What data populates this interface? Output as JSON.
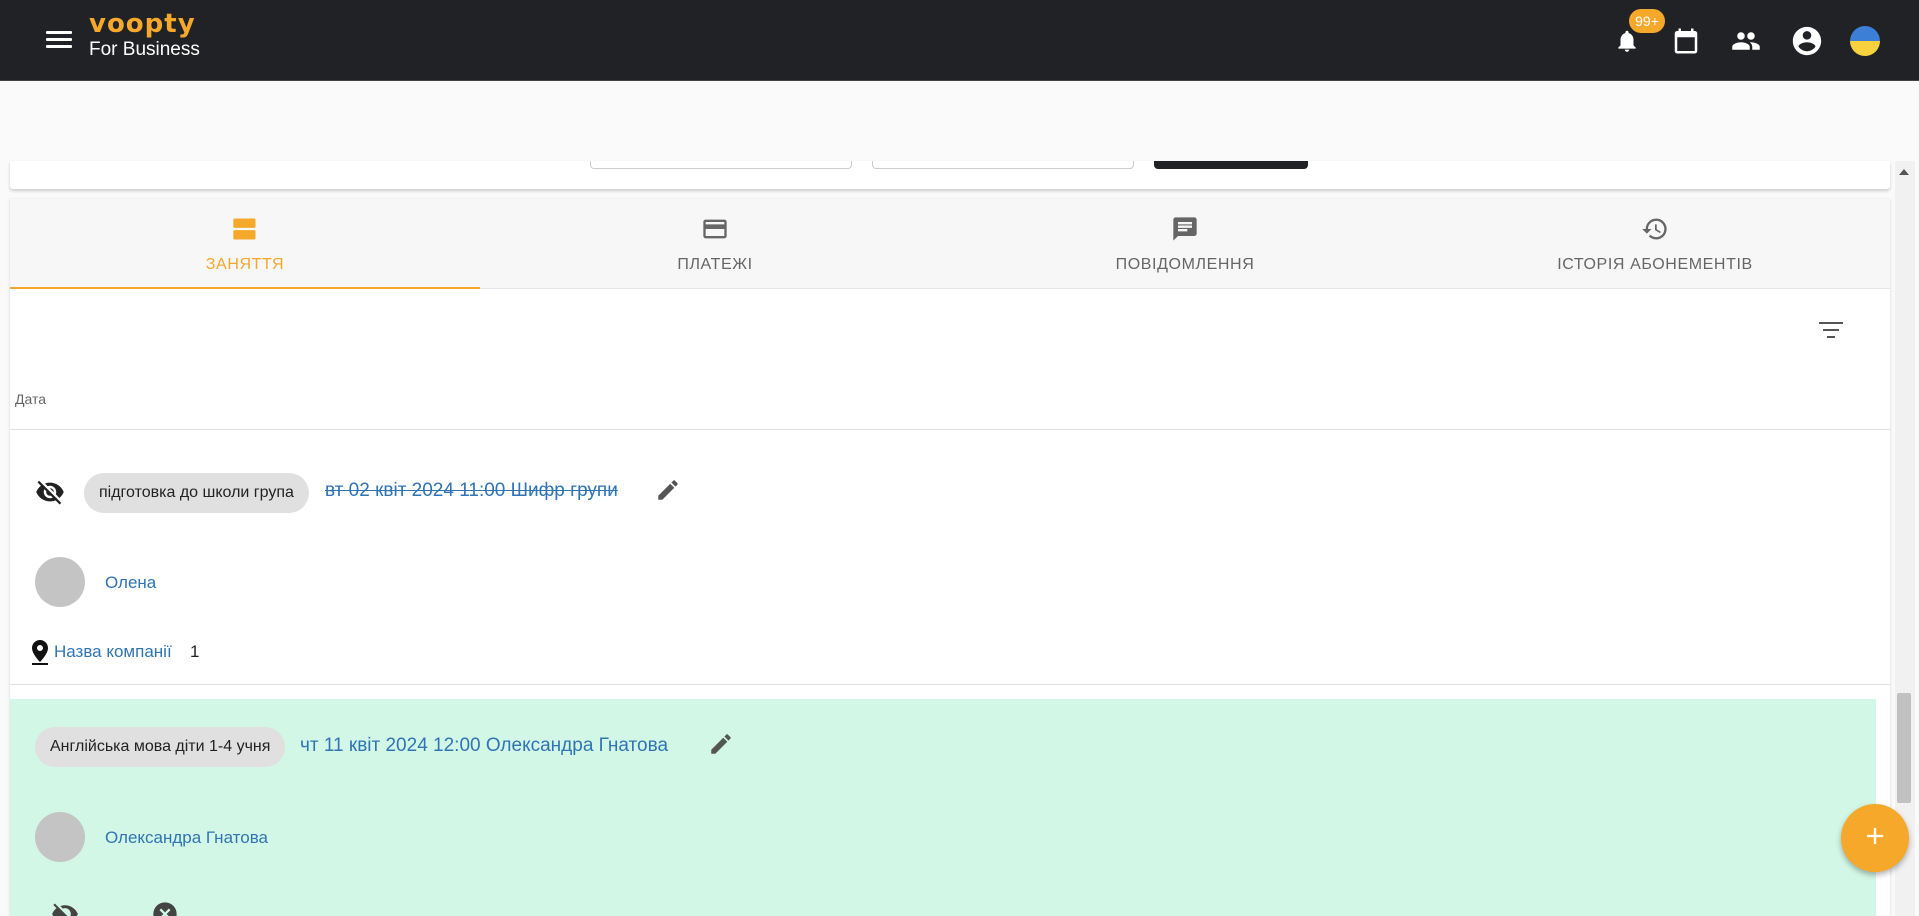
{
  "app": {
    "brand_name": "voopty",
    "brand_sub": "For Business",
    "notification_badge": "99+",
    "accent_color": "#f6a82b",
    "appbar_color": "#212225"
  },
  "header_icons": [
    "notifications-icon",
    "calendar-icon",
    "people-icon",
    "account-icon",
    "ukraine-flag-icon"
  ],
  "tabs": [
    {
      "label": "ЗАНЯТТЯ",
      "icon": "view-agenda-icon",
      "active": true
    },
    {
      "label": "ПЛАТЕЖІ",
      "icon": "credit-card-icon",
      "active": false
    },
    {
      "label": "ПОВІДОМЛЕННЯ",
      "icon": "message-icon",
      "active": false
    },
    {
      "label": "ІСТОРІЯ АБОНЕМЕНТІВ",
      "icon": "history-icon",
      "active": false
    }
  ],
  "table": {
    "column_header": "Дата"
  },
  "lessons": [
    {
      "group": "підготовка до школи група",
      "title": "вт 02 квіт 2024 11:00 Шифр групи",
      "cancelled": true,
      "teacher": "Олена",
      "location": "Назва компанії",
      "count": "1"
    },
    {
      "group": "Англійська мова діти 1-4 учня",
      "title": "чт 11 квіт 2024 12:00 Олександра Гнатова",
      "cancelled": false,
      "highlight_color": "#d3f7e6",
      "teacher": "Олександра Гнатова"
    }
  ],
  "fab_icon": "add-icon"
}
